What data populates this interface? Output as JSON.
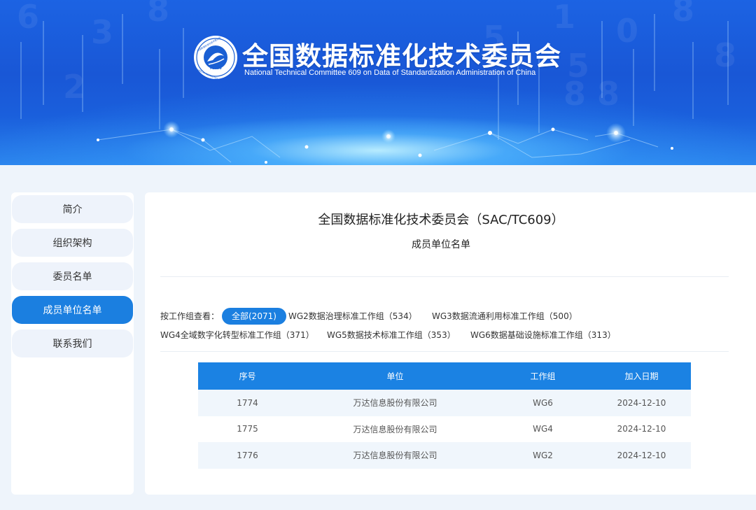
{
  "header": {
    "logo": {
      "icon": "committee-seal-logo",
      "code": "TC609"
    },
    "title_cn": "全国数据标准化技术委员会",
    "title_en": "National Technical Committee 609 on Data of Standardization Administration of China"
  },
  "sidebar": {
    "items": [
      {
        "label": "简介",
        "active": false
      },
      {
        "label": "组织架构",
        "active": false
      },
      {
        "label": "委员名单",
        "active": false
      },
      {
        "label": "成员单位名单",
        "active": true
      },
      {
        "label": "联系我们",
        "active": false
      }
    ]
  },
  "main": {
    "title": "全国数据标准化技术委员会（SAC/TC609）",
    "subtitle": "成员单位名单",
    "filter": {
      "label": "按工作组查看：",
      "options": [
        {
          "label": "全部(2071)",
          "active": true
        },
        {
          "label": "WG2数据治理标准工作组（534）",
          "active": false
        },
        {
          "label": "WG3数据流通利用标准工作组（500）",
          "active": false
        },
        {
          "label": "WG4全域数字化转型标准工作组（371）",
          "active": false
        },
        {
          "label": "WG5数据技术标准工作组（353）",
          "active": false
        },
        {
          "label": "WG6数据基础设施标准工作组（313）",
          "active": false
        }
      ]
    },
    "table": {
      "headers": [
        "序号",
        "单位",
        "工作组",
        "加入日期"
      ],
      "rows": [
        [
          "1774",
          "万达信息股份有限公司",
          "WG6",
          "2024-12-10"
        ],
        [
          "1775",
          "万达信息股份有限公司",
          "WG4",
          "2024-12-10"
        ],
        [
          "1776",
          "万达信息股份有限公司",
          "WG2",
          "2024-12-10"
        ]
      ]
    }
  },
  "colors": {
    "accent": "#1b7fe0",
    "table_header": "#1b82e3",
    "banner": "#1957d6"
  }
}
